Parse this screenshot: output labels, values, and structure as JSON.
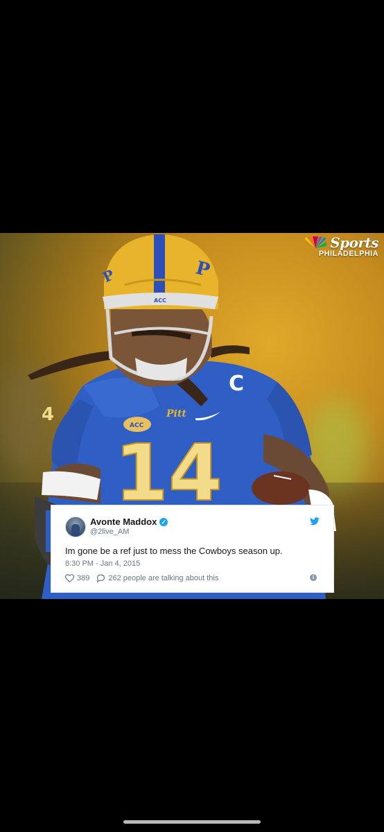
{
  "branding": {
    "sports": "Sports",
    "region": "PHILADELPHIA"
  },
  "tweet": {
    "author_name": "Avonte Maddox",
    "handle": "@2live_AM",
    "text": "Im gone be a ref just to mess the Cowboys season up.",
    "timestamp": "8:30 PM - Jan 4, 2015",
    "likes": "389",
    "replies_text": "262 people are talking about this"
  },
  "photo": {
    "jersey_number": "14",
    "captain_patch": "C",
    "team_wordmark": "Pitt"
  },
  "colors": {
    "twitter_blue": "#1da1f2",
    "jersey_blue": "#2f5fc4",
    "helmet_gold": "#e8b42c"
  }
}
